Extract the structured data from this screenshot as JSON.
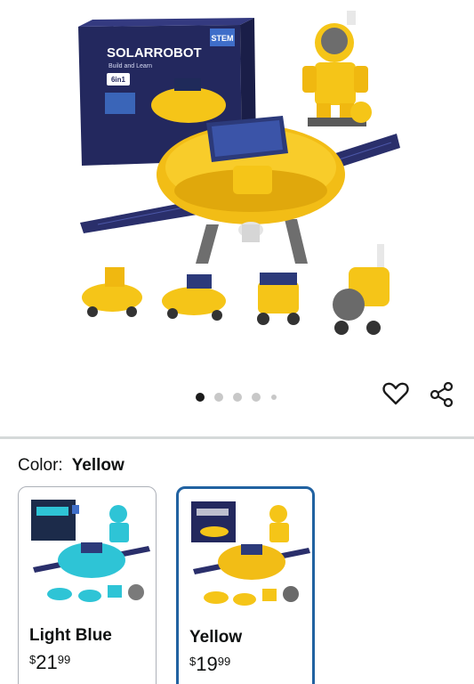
{
  "product_image": {
    "box_title": "SOLARROBOT",
    "box_subtitle": "Build and Learn",
    "box_badge": "STEM",
    "box_count_badge": "6in1",
    "carousel_count": 5,
    "carousel_active_index": 0
  },
  "actions": {
    "favorite_icon": "heart-outline-icon",
    "share_icon": "share-icon"
  },
  "color_selector": {
    "label": "Color:",
    "selected_value": "Yellow"
  },
  "swatches": [
    {
      "name": "Light Blue",
      "currency": "$",
      "whole": "21",
      "fraction": "99",
      "selected": false,
      "accent": "#2ec4d6"
    },
    {
      "name": "Yellow",
      "currency": "$",
      "whole": "19",
      "fraction": "99",
      "selected": true,
      "accent": "#f5c518"
    }
  ],
  "colors": {
    "selected_border": "#2162a1",
    "robot_yellow": "#f5c518",
    "robot_blue": "#2ec4d6",
    "panel_navy": "#2a2f6b"
  }
}
